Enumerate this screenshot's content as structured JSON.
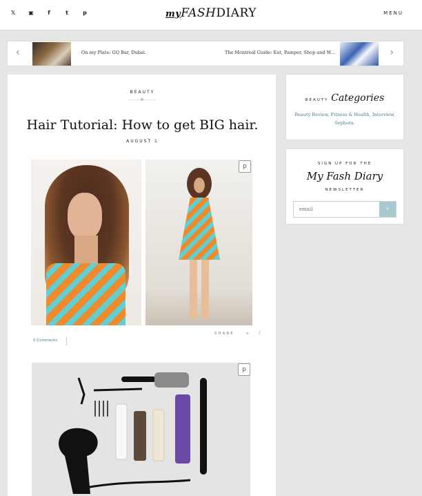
{
  "header": {
    "social": [
      {
        "name": "twitter-icon",
        "glyph": "𝕏"
      },
      {
        "name": "instagram-icon",
        "glyph": "▣"
      },
      {
        "name": "facebook-icon",
        "glyph": "f"
      },
      {
        "name": "tumblr-icon",
        "glyph": "t"
      },
      {
        "name": "pinterest-icon",
        "glyph": "p"
      }
    ],
    "logo_my": "my",
    "logo_fash": "FASH",
    "logo_diary": "DIARY",
    "menu": "MENU"
  },
  "slider": {
    "prev": "‹",
    "next": "›",
    "items": [
      {
        "title": "On my Plate: GQ Bar, Dubai."
      },
      {
        "title": "The Montreal Guide: Eat, Pamper, Shop and W..."
      }
    ]
  },
  "article": {
    "category": "BEAUTY",
    "title": "Hair Tutorial: How to get BIG hair.",
    "date": "AUGUST 1",
    "comments": "0 Comments",
    "share": "SHARE",
    "share_icons": {
      "twitter": "✦",
      "facebook": "f"
    },
    "pin_glyph": "p"
  },
  "sidebar": {
    "categories": {
      "head": "BEAUTY",
      "script": "Categories",
      "links": "Beauty Review, Fitness & Health, Interview, Sephora."
    },
    "newsletter": {
      "head": "SIGN UP FOR THE",
      "script": "My Fash Diary",
      "sub": "NEWSLETTER",
      "placeholder": "email",
      "go": "›"
    }
  },
  "colors": {
    "accent": "#a9c9d1",
    "link": "#4a7d8c"
  }
}
